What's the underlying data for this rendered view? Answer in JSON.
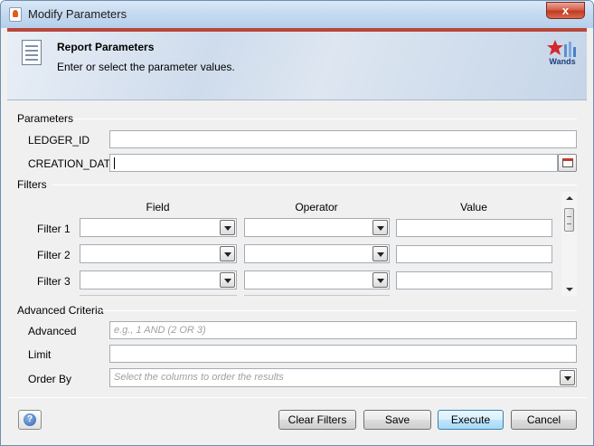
{
  "window": {
    "title": "Modify Parameters",
    "close_label": "x"
  },
  "banner": {
    "title": "Report Parameters",
    "subtitle": "Enter or select the parameter values.",
    "logo_text": "Wands"
  },
  "parameters": {
    "section_label": "Parameters",
    "fields": [
      {
        "label": "LEDGER_ID",
        "value": ""
      },
      {
        "label": "CREATION_DATE",
        "value": ""
      }
    ]
  },
  "filters": {
    "section_label": "Filters",
    "columns": {
      "field": "Field",
      "operator": "Operator",
      "value": "Value"
    },
    "rows": [
      {
        "label": "Filter 1",
        "field": "",
        "operator": "",
        "value": ""
      },
      {
        "label": "Filter 2",
        "field": "",
        "operator": "",
        "value": ""
      },
      {
        "label": "Filter 3",
        "field": "",
        "operator": "",
        "value": ""
      }
    ]
  },
  "advanced": {
    "section_label": "Advanced Criteria",
    "advanced_label": "Advanced",
    "advanced_placeholder": "e.g., 1 AND (2 OR 3)",
    "limit_label": "Limit",
    "limit_value": "",
    "order_by_label": "Order By",
    "order_by_placeholder": "Select the columns to order the results"
  },
  "footer": {
    "help_label": "?",
    "clear_filters": "Clear Filters",
    "save": "Save",
    "execute": "Execute",
    "cancel": "Cancel"
  },
  "colors": {
    "accent": "#b8463a",
    "default_button": "#3c7fb1"
  }
}
